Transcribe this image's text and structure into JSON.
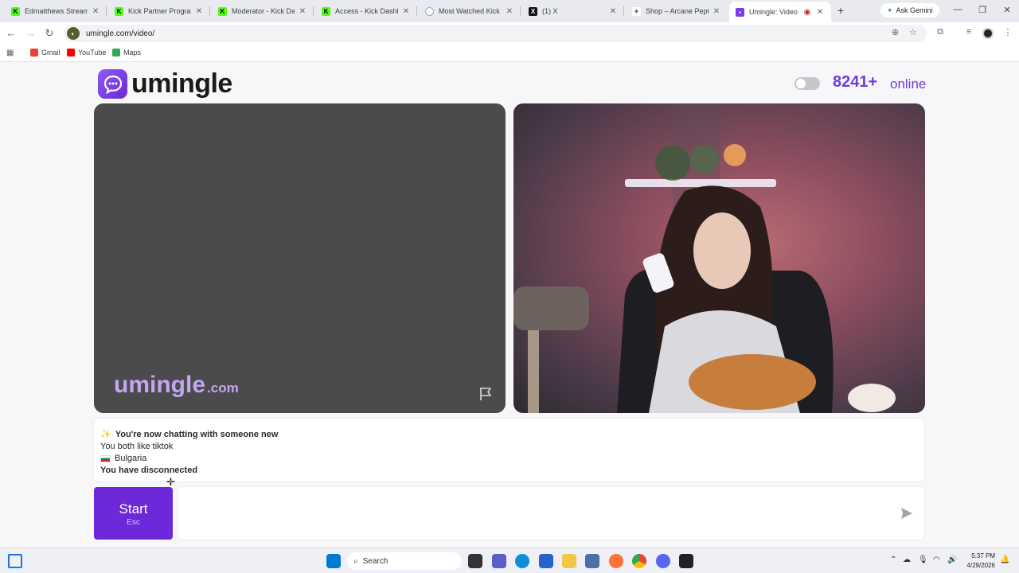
{
  "browser": {
    "tabs": [
      {
        "title": "Edmatthews Stream - Y",
        "favicon_color": "#53fc18"
      },
      {
        "title": "Kick Partner Program -",
        "favicon_color": "#53fc18"
      },
      {
        "title": "Moderator - Kick Dashb",
        "favicon_color": "#53fc18"
      },
      {
        "title": "Access - Kick Dashboar",
        "favicon_color": "#53fc18"
      },
      {
        "title": "Most Watched Kick Stre",
        "favicon_color": "#9aa0e6"
      },
      {
        "title": "(1) X",
        "favicon_color": "#111111"
      },
      {
        "title": "Shop – Arcane Peptide",
        "favicon_color": "#777777"
      },
      {
        "title": "Umingle: Video Ch",
        "favicon_color": "#7c3aed"
      }
    ],
    "ask_gemini": "Ask Gemini",
    "url": "umingle.com/video/",
    "bookmarks": [
      {
        "label": "Gmail",
        "color": "#ea4335"
      },
      {
        "label": "YouTube",
        "color": "#ff0000"
      },
      {
        "label": "Maps",
        "color": "#34a853"
      }
    ]
  },
  "site": {
    "logo_text": "umingle",
    "online_count": "8241+",
    "online_label": "online",
    "watermark_main": "umingle",
    "watermark_domain": ".com",
    "accent": "#6d28d9"
  },
  "chat": {
    "messages": [
      {
        "icon": "✨",
        "text": "You're now chatting with someone new",
        "bold": true
      },
      {
        "icon": "",
        "text": "You both like tiktok",
        "bold": false
      },
      {
        "icon": "flag",
        "text": "Bulgaria",
        "bold": false
      },
      {
        "icon": "",
        "text": "You have disconnected",
        "bold": true
      }
    ],
    "start_label": "Start",
    "start_hint": "Esc",
    "input_value": ""
  },
  "taskbar": {
    "search_label": "Search",
    "time": "5:37 PM",
    "date": "4/29/2026"
  }
}
